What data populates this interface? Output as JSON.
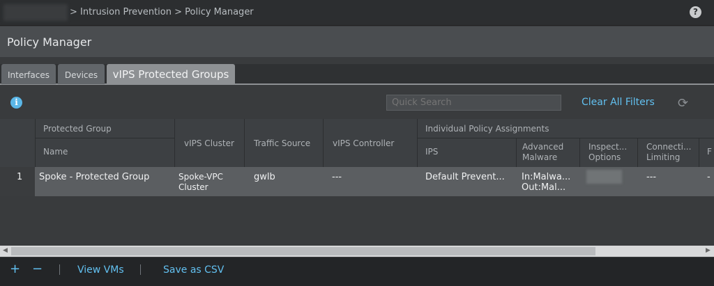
{
  "breadcrumb": "> Intrusion Prevention > Policy Manager",
  "help_icon": "?",
  "title": "Policy Manager",
  "tabs": [
    "Interfaces",
    "Devices",
    "vIPS Protected Groups"
  ],
  "toolbar": {
    "search_placeholder": "Quick Search",
    "clear_filters": "Clear All Filters"
  },
  "table": {
    "group_headers": {
      "protected_group": "Protected Group",
      "policy": "Individual Policy Assignments"
    },
    "columns": [
      "Name",
      "vIPS Cluster",
      "Traffic Source",
      "vIPS Controller",
      "IPS",
      "Advanced Malware",
      "Inspect... Options",
      "Connecti... Limiting",
      "F"
    ],
    "rows": [
      {
        "num": "1",
        "name": "Spoke - Protected Group",
        "cluster": "Spoke-VPC Cluster",
        "source": "gwlb",
        "controller": "---",
        "ips": "Default Prevent...",
        "malware_in": "In:Malwa...",
        "malware_out": "Out:Mal...",
        "connection": "---",
        "f": "-"
      }
    ]
  },
  "footer": {
    "add": "+",
    "remove": "−",
    "view_vms": "View VMs",
    "save_csv": "Save as CSV"
  }
}
